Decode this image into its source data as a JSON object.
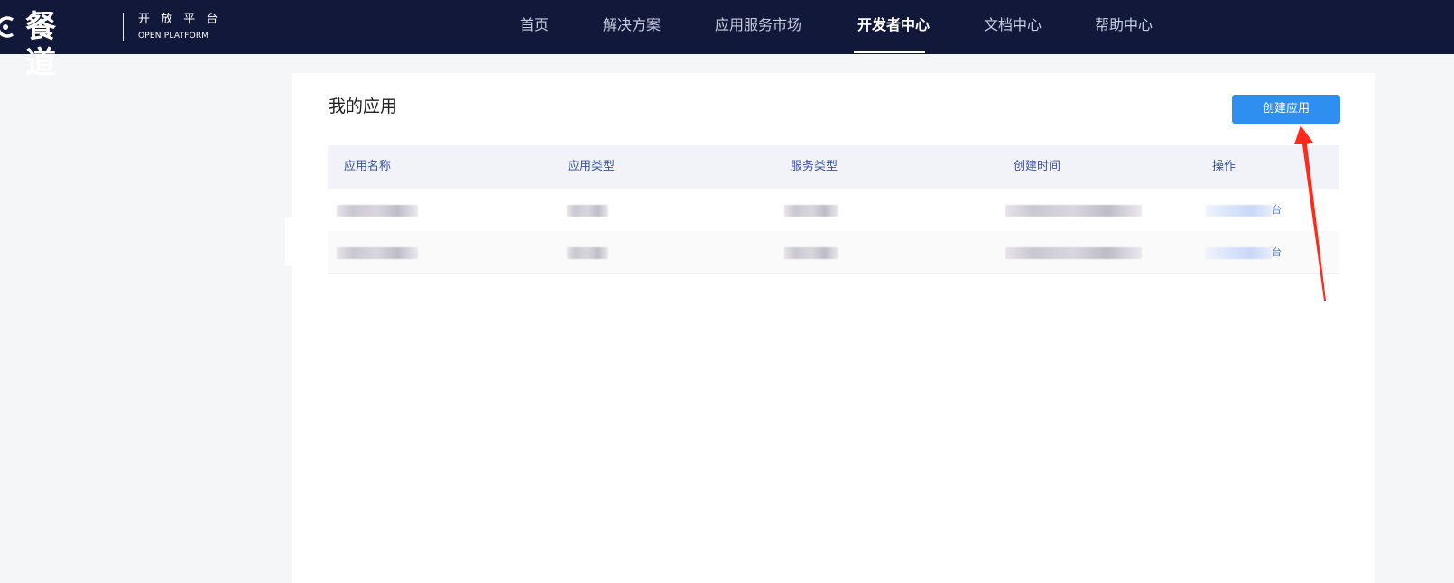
{
  "brand": {
    "logo_text": "餐道",
    "platform_cn": "开 放 平 台",
    "platform_en": "OPEN PLATFORM"
  },
  "nav": {
    "items": [
      {
        "label": "首页",
        "active": false
      },
      {
        "label": "解决方案",
        "active": false
      },
      {
        "label": "应用服务市场",
        "active": false
      },
      {
        "label": "开发者中心",
        "active": true
      },
      {
        "label": "文档中心",
        "active": false
      },
      {
        "label": "帮助中心",
        "active": false
      }
    ]
  },
  "page": {
    "title": "我的应用",
    "create_button": "创建应用"
  },
  "table": {
    "headers": [
      "应用名称",
      "应用类型",
      "服务类型",
      "创建时间",
      "操作"
    ],
    "rows": [
      {
        "name": "",
        "app_type": "",
        "service_type": "",
        "created": "",
        "action": "台"
      },
      {
        "name": "",
        "app_type": "",
        "service_type": "",
        "created": "",
        "action": "台"
      }
    ]
  },
  "colors": {
    "topbar": "#11183a",
    "primary": "#2f8ff0",
    "header_text": "#3a54a4",
    "annotation_arrow": "#ff2a1a"
  }
}
